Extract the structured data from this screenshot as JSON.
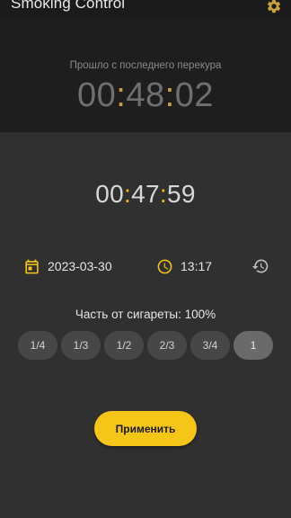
{
  "app": {
    "title": "Smoking Control"
  },
  "hero": {
    "caption": "Прошло с последнего перекура",
    "timer": {
      "hh": "00",
      "mm": "48",
      "ss": "02"
    }
  },
  "entry": {
    "timer": {
      "hh": "00",
      "mm": "47",
      "ss": "59"
    },
    "date": "2023-03-30",
    "time": "13:17",
    "fraction_label": "Часть от сигареты: 100%",
    "fractions": [
      "1/4",
      "1/3",
      "1/2",
      "2/3",
      "3/4",
      "1"
    ],
    "selected_fraction": "1",
    "apply_label": "Применить"
  },
  "icons": {
    "settings": "gear-icon",
    "date": "calendar-icon",
    "time": "clock-icon",
    "history": "history-icon"
  },
  "colors": {
    "accent": "#f5c518",
    "background": "#303030",
    "hero_background": "#1e1e1e"
  }
}
